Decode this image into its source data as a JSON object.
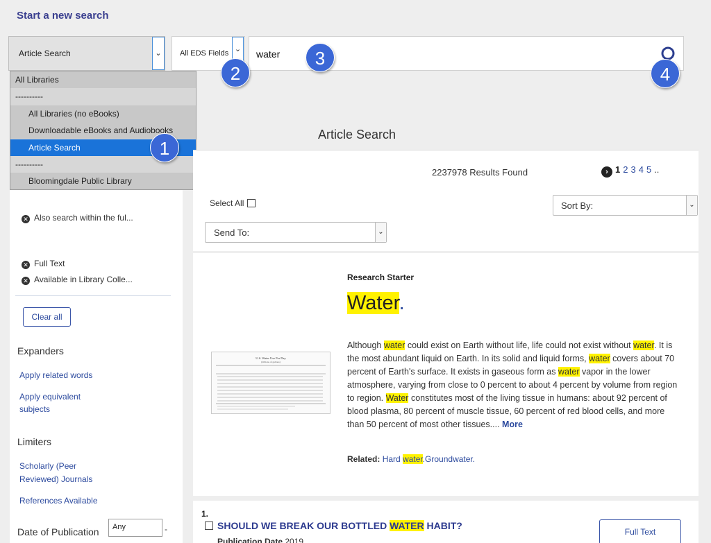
{
  "header": {
    "start_new_search": "Start a new search"
  },
  "search": {
    "database": "Article Search",
    "field": "All EDS Fields",
    "query": "water"
  },
  "badges": [
    "1",
    "2",
    "3",
    "4"
  ],
  "dropdown": {
    "options": [
      {
        "label": "All Libraries",
        "type": "header"
      },
      {
        "label": "----------",
        "type": "separator"
      },
      {
        "label": "All Libraries (no eBooks)",
        "type": "item"
      },
      {
        "label": "Downloadable eBooks and Audiobooks",
        "type": "item"
      },
      {
        "label": "Article Search",
        "type": "selected"
      },
      {
        "label": "----------",
        "type": "separator"
      },
      {
        "label": "Bloomingdale Public Library",
        "type": "item"
      }
    ]
  },
  "sidebar": {
    "filters": [
      "Also search within the ful...",
      "Full Text",
      "Available in Library Colle..."
    ],
    "clear_all": "Clear all",
    "expanders_heading": "Expanders",
    "expanders": [
      "Apply related words",
      "Apply equivalent",
      "subjects"
    ],
    "limiters_heading": "Limiters",
    "limiters": [
      "Scholarly (Peer",
      "Reviewed) Journals",
      "References Available"
    ],
    "date_heading": "Date of Publication",
    "date_from": "Any",
    "date_dash": "-"
  },
  "main": {
    "title": "Article Search",
    "results_count": "2237978 Results Found",
    "pagination": {
      "current": "1",
      "pages": [
        "2",
        "3",
        "4",
        "5"
      ],
      "ellipsis": ".."
    },
    "select_all": "Select All",
    "sort_by": "Sort By:",
    "send_to": "Send To:"
  },
  "starter": {
    "label": "Research Starter",
    "title": "Water",
    "title_dot": ".",
    "body_segments": [
      {
        "t": "Although ",
        "hl": false
      },
      {
        "t": "water",
        "hl": true
      },
      {
        "t": " could exist on Earth without life, life could not exist without ",
        "hl": false
      },
      {
        "t": "water",
        "hl": true
      },
      {
        "t": ". It is the most abundant liquid on Earth. In its solid and liquid forms, ",
        "hl": false
      },
      {
        "t": "water",
        "hl": true
      },
      {
        "t": " covers about 70 percent of Earth's surface. It exists in gaseous form as ",
        "hl": false
      },
      {
        "t": "water",
        "hl": true
      },
      {
        "t": " vapor in the lower atmosphere, varying from close to 0 percent to about 4 percent by volume from region to region. ",
        "hl": false
      },
      {
        "t": "Water",
        "hl": true
      },
      {
        "t": " constitutes most of the living tissue in humans: about 92 percent of blood plasma, 80 percent of muscle tissue, 60 percent of red blood cells, and more than 50 percent of most other tissues.... ",
        "hl": false
      }
    ],
    "more": "More",
    "related_label": "Related:",
    "related_pre": "Hard ",
    "related_hl": "water",
    "related_post": ".Groundwater.",
    "image_title": "U.S. Water Use Per Day",
    "image_subtitle": "(billions of gallons)"
  },
  "result1": {
    "number": "1.",
    "title_pre": "SHOULD WE BREAK OUR BOTTLED ",
    "title_hl": "WATER",
    "title_post": " HABIT?",
    "meta_label": "Publication Date",
    "meta_value": "2019",
    "full_text": "Full Text"
  }
}
